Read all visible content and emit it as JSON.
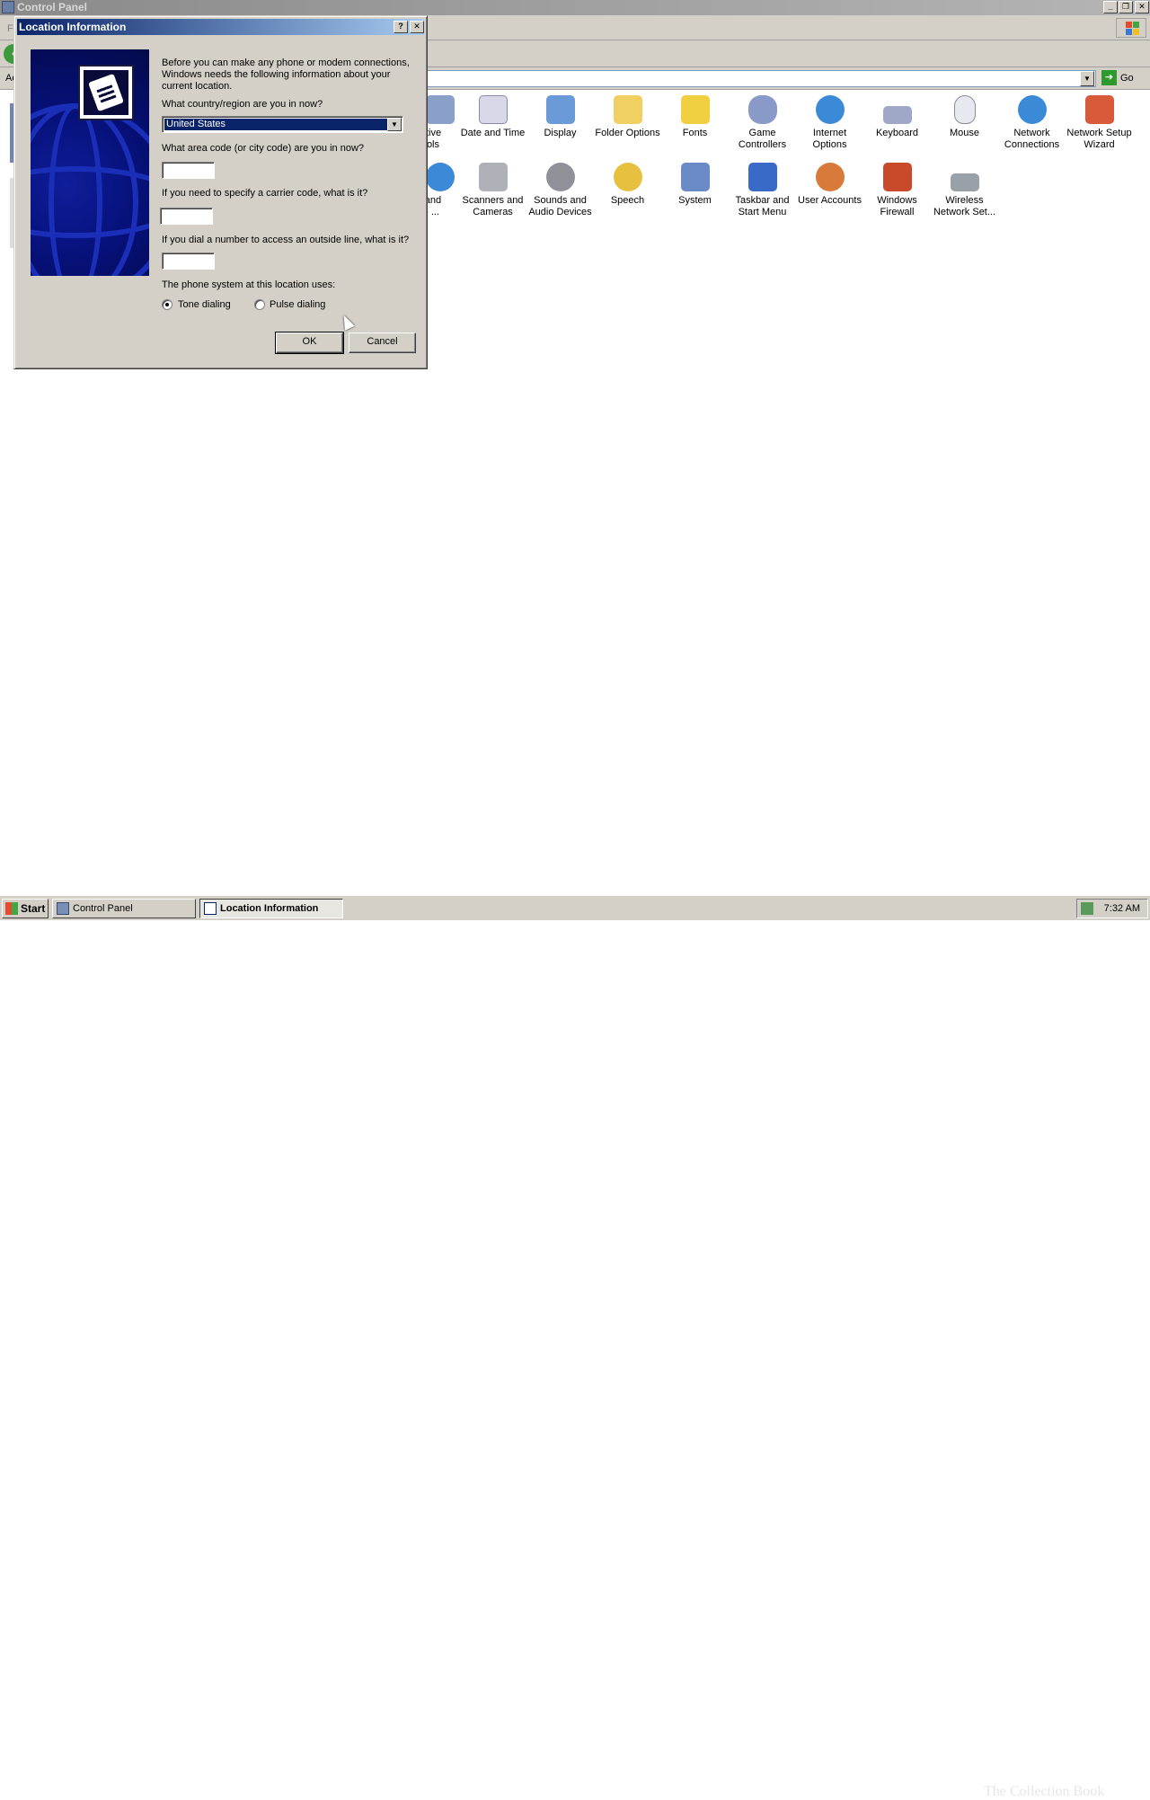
{
  "control_panel": {
    "title": "Control Panel",
    "menu_partial": "F",
    "address_partial": "Ac",
    "go_label": "Go",
    "items": [
      {
        "label": "...trative\nols",
        "icon": "administrative-tools-icon",
        "color": "#8aa0c8"
      },
      {
        "label": "Date and Time",
        "icon": "date-time-icon",
        "color": "#d8d8e8"
      },
      {
        "label": "Display",
        "icon": "display-icon",
        "color": "#6a9ad8"
      },
      {
        "label": "Folder Options",
        "icon": "folder-options-icon",
        "color": "#f0d060"
      },
      {
        "label": "Fonts",
        "icon": "fonts-icon",
        "color": "#f0d040"
      },
      {
        "label": "Game\nControllers",
        "icon": "game-controllers-icon",
        "color": "#8a9ac8"
      },
      {
        "label": "Internet\nOptions",
        "icon": "internet-options-icon",
        "color": "#3a8ad8"
      },
      {
        "label": "Keyboard",
        "icon": "keyboard-icon",
        "color": "#a0a8c8"
      },
      {
        "label": "Mouse",
        "icon": "mouse-icon",
        "color": "#e8e8f0"
      },
      {
        "label": "Network\nConnections",
        "icon": "network-connections-icon",
        "color": "#3a8ad8"
      },
      {
        "label": "Network Setup\nWizard",
        "icon": "network-setup-wizard-icon",
        "color": "#d85a3a"
      },
      {
        "label": "...al and\n...ge ...",
        "icon": "regional-language-icon",
        "color": "#3a8ad8"
      },
      {
        "label": "Scanners and\nCameras",
        "icon": "scanners-cameras-icon",
        "color": "#b0b0b8"
      },
      {
        "label": "Sounds and\nAudio Devices",
        "icon": "sounds-audio-icon",
        "color": "#909098"
      },
      {
        "label": "Speech",
        "icon": "speech-icon",
        "color": "#e8c040"
      },
      {
        "label": "System",
        "icon": "system-icon",
        "color": "#6a8ac8"
      },
      {
        "label": "Taskbar and\nStart Menu",
        "icon": "taskbar-start-menu-icon",
        "color": "#3a6ac8"
      },
      {
        "label": "User Accounts",
        "icon": "user-accounts-icon",
        "color": "#d87a3a"
      },
      {
        "label": "Windows\nFirewall",
        "icon": "windows-firewall-icon",
        "color": "#c84a2a"
      },
      {
        "label": "Wireless\nNetwork Set...",
        "icon": "wireless-network-icon",
        "color": "#9aa0a8"
      }
    ]
  },
  "dialog": {
    "title": "Location Information",
    "help_btn": "?",
    "close_btn": "✕",
    "intro": "Before you can make any phone or modem connections, Windows needs the following information about your current location.",
    "country_question": "What country/region are you in now?",
    "country_value": "United States",
    "area_question": "What area code (or city code) are you in now?",
    "area_value": "",
    "carrier_question": "If you need to specify a carrier code, what is it?",
    "carrier_value": "",
    "outside_question": "If you dial a number to access an outside line, what is it?",
    "outside_value": "",
    "phone_system_label": "The phone system at this location uses:",
    "tone_label": "Tone dialing",
    "pulse_label": "Pulse dialing",
    "selected_dialing": "tone",
    "ok_label": "OK",
    "cancel_label": "Cancel"
  },
  "taskbar": {
    "start_label": "Start",
    "tasks": [
      {
        "label": "Control Panel",
        "active": false
      },
      {
        "label": "Location Information",
        "active": true
      }
    ],
    "clock": "7:32 AM",
    "watermark": "The Collection Book"
  }
}
